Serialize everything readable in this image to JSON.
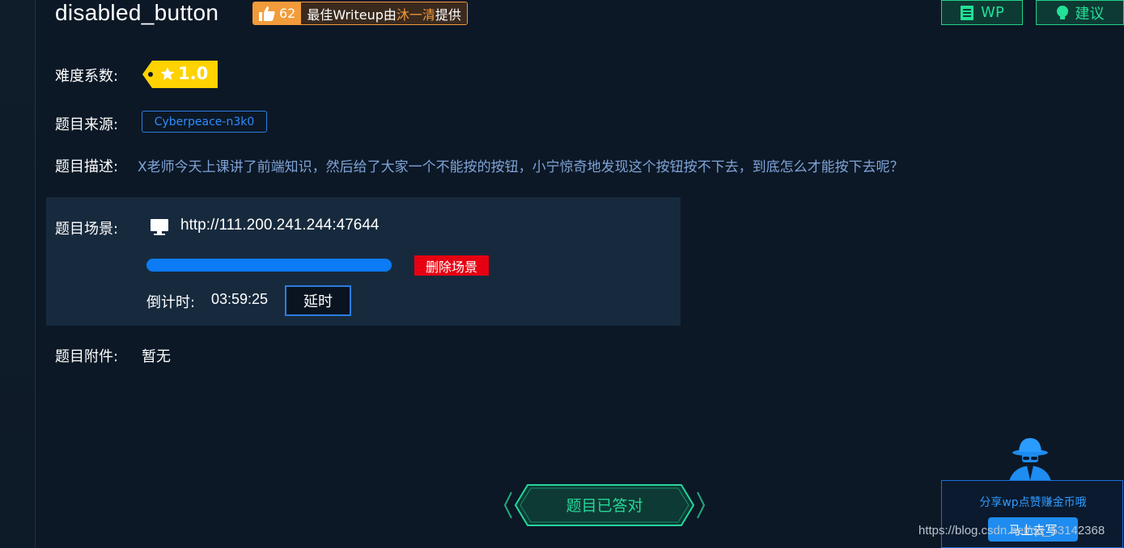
{
  "challenge": {
    "title": "disabled_button",
    "writeup_badge": {
      "likes": "62",
      "text_prefix": "最佳Writeup由",
      "author": "沐一清",
      "text_suffix": "提供"
    }
  },
  "top_buttons": {
    "wp_label": "WP",
    "suggest_label": "建议"
  },
  "details": {
    "difficulty_label": "难度系数:",
    "difficulty_value": "1.0",
    "source_label": "题目来源:",
    "source_value": "Cyberpeace-n3k0",
    "description_label": "题目描述:",
    "description_value": "X老师今天上课讲了前端知识，然后给了大家一个不能按的按钮，小宁惊奇地发现这个按钮按不下去，到底怎么才能按下去呢？"
  },
  "scene": {
    "label": "题目场景:",
    "url": "http://111.200.241.244:47644",
    "progress_percent": 100,
    "delete_label": "删除场景",
    "countdown_label": "倒计时:",
    "countdown_value": "03:59:25",
    "extend_label": "延时"
  },
  "attachment": {
    "label": "题目附件:",
    "value": "暂无"
  },
  "status_button": {
    "label": "题目已答对"
  },
  "share_card": {
    "text": "分享wp点赞赚金币哦",
    "button_label": "马上去写"
  },
  "watermark": "https://blog.csdn.net/qq_53142368",
  "colors": {
    "accent_blue": "#2f8cff",
    "accent_green": "#22e096",
    "accent_orange": "#f29b3a",
    "danger_red": "#e60012",
    "difficulty_yellow": "#ffd200",
    "background": "#0c1826"
  },
  "icons": {
    "like": "thumbs-up-icon",
    "wp": "document-icon",
    "suggest": "lightbulb-icon",
    "difficulty": "star-icon",
    "scene": "monitor-icon",
    "share": "spy-mascot-icon"
  }
}
